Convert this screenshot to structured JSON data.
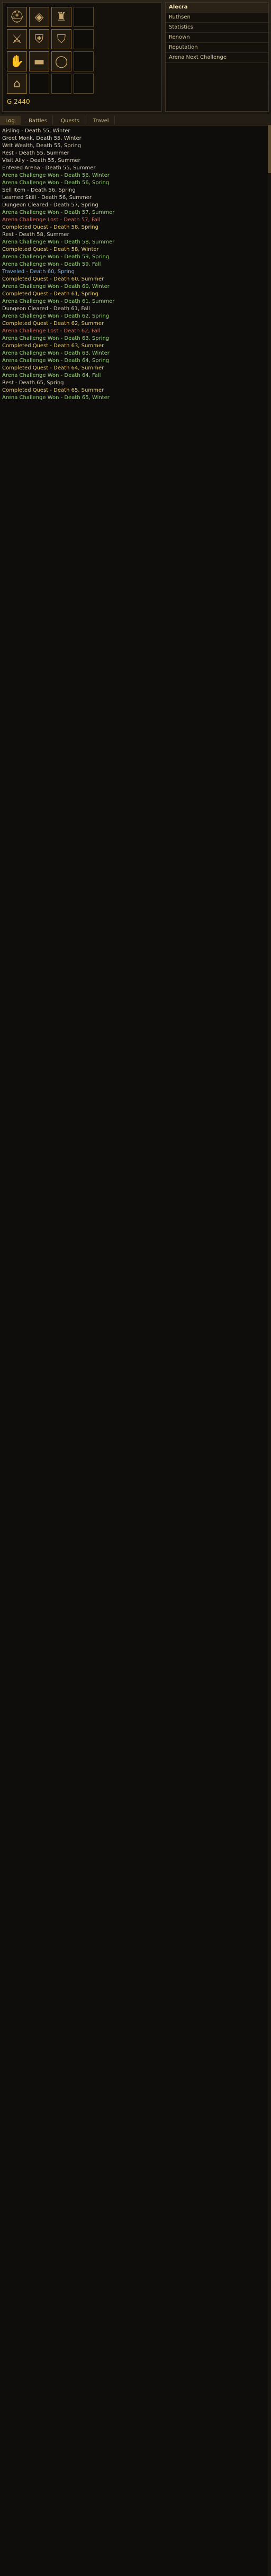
{
  "character": {
    "name": "Alecra",
    "rows": [
      "Ruthsen",
      "Statistics",
      "Renown",
      "Reputation",
      "Arena Next Challenge"
    ]
  },
  "gold": "G 2440",
  "tabs": [
    "Log",
    "Battles",
    "Quests",
    "Travel"
  ],
  "log_lines": [
    "Aisling - Death 55, Winter",
    "Greet Monk, Death 55, Winter",
    "Writ Wealth, Death 55, Spring",
    "Rest - Death 55, Summer",
    "Visit Ally - Death 55, Summer",
    "Entered Arena - Death 55, Summer",
    "Arena Challenge Won - Death 56, Winter",
    "Arena Challenge Won - Death 56, Spring",
    "Sell Item - Death 56, Spring",
    "Learned Skill - Death 56, Summer",
    "Dungeon Cleared - Death 57, Spring",
    "Arena Challenge Won - Death 57, Summer",
    "Arena Challenge Lost - Death 57, Fall",
    "Completed Quest - Death 58, Spring",
    "Rest - Death 58, Summer",
    "Arena Challenge Won - Death 58, Summer",
    "Completed Quest - Death 58, Winter",
    "Arena Challenge Won - Death 59, Spring",
    "Arena Challenge Won - Death 59, Fall",
    "Traveled - Death 60, Spring",
    "Completed Quest - Death 60, Summer",
    "Arena Challenge Won - Death 60, Winter",
    "Completed Quest - Death 61, Spring",
    "Arena Challenge Won - Death 61, Summer",
    "Dungeon Cleared - Death 61, Fall",
    "Arena Challenge Won - Death 62, Spring",
    "Completed Quest - Death 62, Summer",
    "Arena Challenge Lost - Death 62, Fall",
    "Arena Challenge Won - Death 63, Spring",
    "Completed Quest - Death 63, Summer",
    "Arena Challenge Won - Death 63, Winter",
    "Arena Challenge Won - Death 64, Spring",
    "Completed Quest - Death 64, Summer",
    "Arena Challenge Won - Death 64, Fall",
    "Rest - Death 65, Spring",
    "Completed Quest - Death 65, Summer",
    "Arena Challenge Won - Death 65, Winter"
  ],
  "colors": {
    "default": "#d8cdb4",
    "won": "#8fcf6a",
    "lost": "#d86a5a",
    "quest": "#e8c860",
    "travel": "#7fb4e0"
  }
}
